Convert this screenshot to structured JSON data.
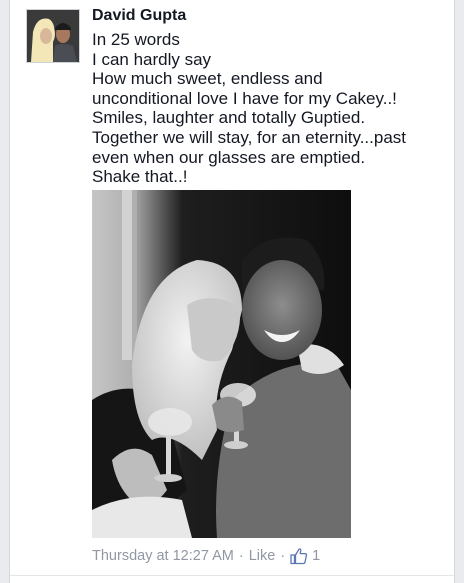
{
  "post": {
    "author": "David Gupta",
    "lines": [
      "In 25 words",
      "I can hardly say",
      "How much sweet, endless and",
      "unconditional love I have for my Cakey..!",
      "Smiles, laughter and totally Guptied.",
      "Together we will stay, for an eternity...past",
      "even when our glasses are emptied.",
      "Shake that..!"
    ]
  },
  "footer": {
    "timestamp": "Thursday at 12:27 AM",
    "separator": "·",
    "like_label": "Like",
    "like_count": "1"
  },
  "colors": {
    "accent": "#3b5998",
    "meta": "#9197a3",
    "text": "#141823"
  },
  "icons": {
    "like": "thumbs-up-icon"
  }
}
